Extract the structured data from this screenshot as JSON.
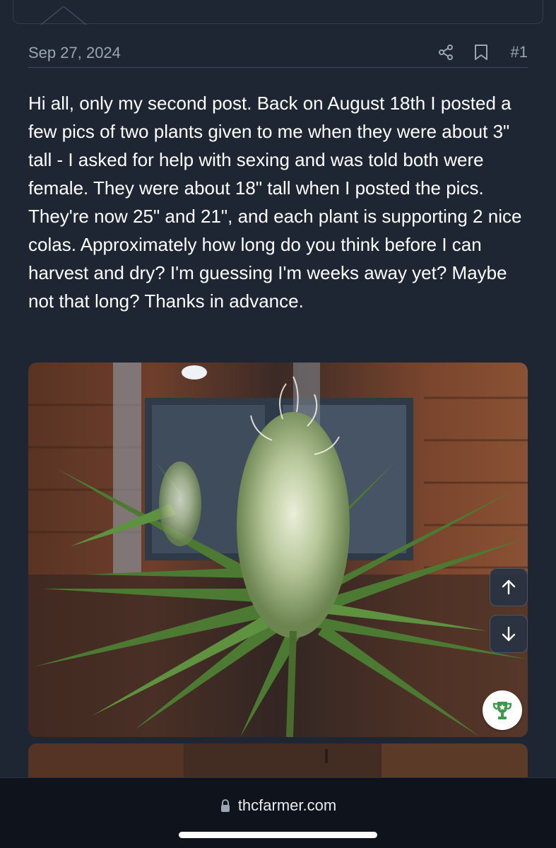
{
  "post": {
    "date": "Sep 27, 2024",
    "number": "#1",
    "body": "Hi all, only my second post. Back on August 18th I posted a few pics of two plants given to me when they were about 3\" tall - I asked for help with sexing and was told both were female. They were about 18\" tall when I posted the pics. They're now 25\" and 21\", and each plant is supporting 2 nice colas. Approximately how long do you think before I can harvest and dry? I'm guessing I'm weeks away yet? Maybe not that long? Thanks in advance.",
    "share_icon": "share-icon",
    "bookmark_icon": "bookmark-icon"
  },
  "attachments": {
    "photo_1_icon": "plant-photo",
    "photo_2_icon": "plant-photo"
  },
  "floating_controls": {
    "scroll_up_icon": "arrow-up-icon",
    "scroll_down_icon": "arrow-down-icon",
    "award_icon": "trophy-icon"
  },
  "browser": {
    "url": "thcfarmer.com",
    "lock_icon": "lock-icon"
  },
  "colors": {
    "background": "#1e2633",
    "text": "#ffffff",
    "muted": "#9aa4b2",
    "divider": "#3b4a60",
    "award_green": "#3a9a4a",
    "browser_bar": "#0f141c"
  }
}
